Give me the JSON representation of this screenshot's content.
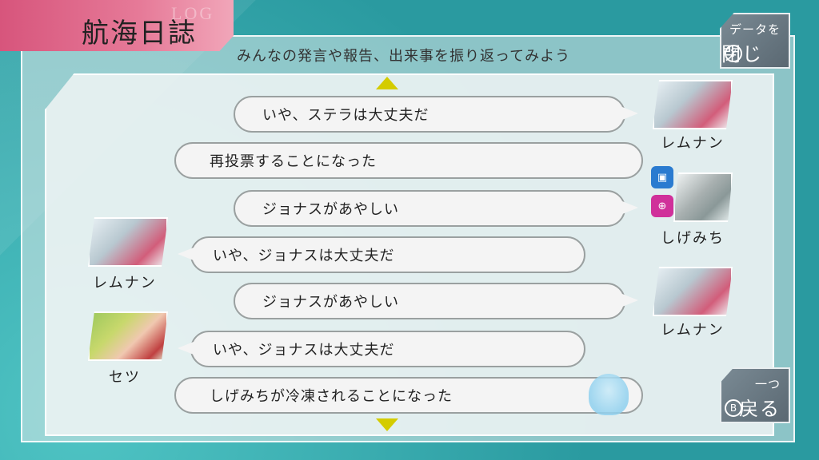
{
  "header": {
    "title": "航海日誌",
    "ghost_label": "LOG",
    "subtitle": "みんなの発言や報告、出来事を振り返ってみよう"
  },
  "buttons": {
    "close_data": {
      "small": "データを",
      "big": "閉じる",
      "key": "Y"
    },
    "back": {
      "small": "一つ",
      "big": "戻る",
      "key": "B"
    }
  },
  "log": [
    {
      "text": "いや、ステラは大丈夫だ",
      "speaker": "レムナン",
      "side": "right"
    },
    {
      "text": "再投票することになった",
      "speaker": "",
      "side": "none"
    },
    {
      "text": "ジョナスがあやしい",
      "speaker": "しげみち",
      "side": "right"
    },
    {
      "text": "いや、ジョナスは大丈夫だ",
      "speaker": "レムナン",
      "side": "left"
    },
    {
      "text": "ジョナスがあやしい",
      "speaker": "レムナン",
      "side": "right"
    },
    {
      "text": "いや、ジョナスは大丈夫だ",
      "speaker": "セツ",
      "side": "left"
    },
    {
      "text": "しげみちが冷凍されることになった",
      "speaker": "",
      "side": "none"
    }
  ],
  "colors": {
    "accent_pink": "#d7557c",
    "arrow_yellow": "#d4cc00",
    "background_teal": "#2a9aa0"
  },
  "icons": {
    "scroll_up": "triangle-up-icon",
    "scroll_down": "triangle-down-icon",
    "robot_blue": "robot-icon",
    "robot_pink": "robot-icon"
  }
}
